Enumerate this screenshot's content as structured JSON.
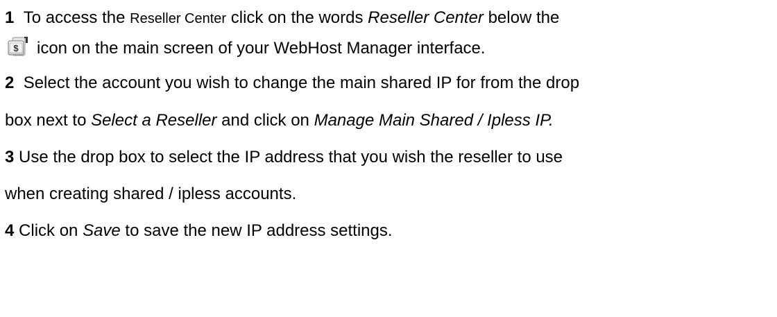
{
  "steps": [
    {
      "number": "1",
      "line1": {
        "t1": "To access the ",
        "t2": "Reseller Center",
        "t3": " click on the words ",
        "t4": "Reseller Center",
        "t5": " below the"
      },
      "icon": {
        "name": "reseller-center-icon",
        "glyph": "$"
      },
      "line2": {
        "t1": "icon on the main screen of your WebHost Manager interface."
      }
    },
    {
      "number": "2",
      "line1": {
        "t1": "Select the account you wish to change the main shared IP for from the drop"
      },
      "line2": {
        "t1": "box next to ",
        "t2": "Select a Reseller",
        "t3": " and click on ",
        "t4": "Manage Main Shared / Ipless IP."
      }
    },
    {
      "number": "3",
      "line1": {
        "t1": "Use the drop box to select the IP address that you wish the reseller to use"
      },
      "line2": {
        "t1": "when creating shared / ipless accounts."
      }
    },
    {
      "number": "4",
      "line1": {
        "t1": "Click on ",
        "t2": "Save",
        "t3": " to save the new IP address settings."
      }
    }
  ]
}
